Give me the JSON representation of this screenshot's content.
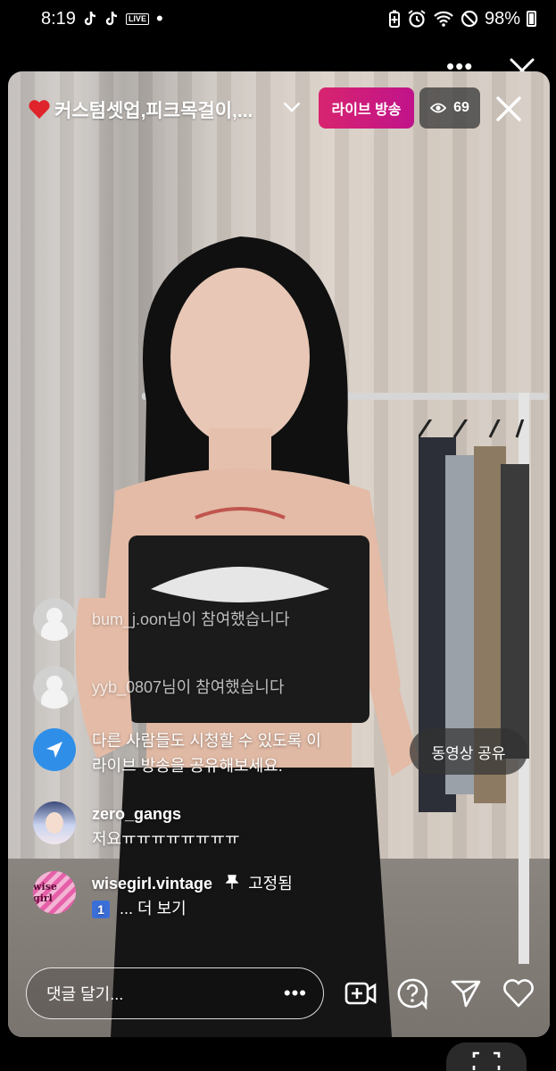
{
  "status_bar": {
    "time": "8:19",
    "live_badge": "LIVE",
    "dot": "•",
    "battery": "98%",
    "icons": [
      "tiktok-icon",
      "tiktok-icon",
      "live-icon",
      "battery-saver-icon",
      "alarm-icon",
      "wifi-icon",
      "do-not-disturb-icon",
      "battery-icon"
    ]
  },
  "header": {
    "title": "커스텀셋업,피크목걸이,...",
    "live_label": "라이브 방송",
    "viewer_count": "69"
  },
  "comments": [
    {
      "kind": "join",
      "text": "bum_j.oon님이 참여했습니다"
    },
    {
      "kind": "join",
      "text": "yyb_0807님이 참여했습니다"
    },
    {
      "kind": "system",
      "text_line1": "다른 사람들도 시청할 수 있도록 이",
      "text_line2": "라이브 방송을 공유해보세요."
    },
    {
      "kind": "user",
      "username": "zero_gangs",
      "text": "저요ㅠㅠㅠㅠㅠㅠㅠㅠ"
    },
    {
      "kind": "pinned",
      "username": "wisegirl.vintage",
      "pin_label": "고정됨",
      "badge": "1",
      "text": "... 더 보기",
      "avatar_text": "wise girl"
    }
  ],
  "share_button": "동영상 공유",
  "comment_input": {
    "placeholder": "댓글 달기...",
    "more": "•••"
  },
  "colors": {
    "live_badge": "#d8246f",
    "share_blue": "#2f8fe8",
    "badge_blue": "#3a6fd8"
  }
}
